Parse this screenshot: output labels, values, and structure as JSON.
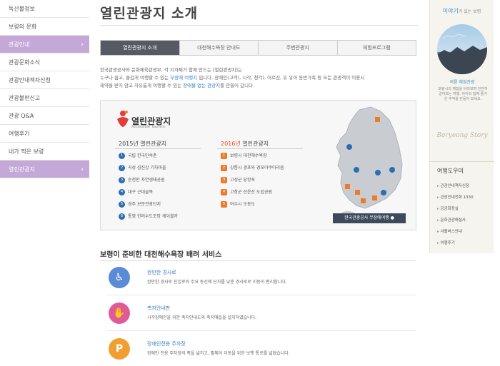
{
  "sidebar": {
    "items": [
      {
        "label": "독산불정보",
        "active": false
      },
      {
        "label": "보령의 문화",
        "active": false
      },
      {
        "label": "관광안내",
        "active": true
      },
      {
        "label": "관광문화소식",
        "active": false
      },
      {
        "label": "관광안내책자신청",
        "active": false
      },
      {
        "label": "관광불편신고",
        "active": false
      },
      {
        "label": "관광 Q&A",
        "active": false
      },
      {
        "label": "여행후기",
        "active": false
      },
      {
        "label": "내가 찍은 보령",
        "active": false
      },
      {
        "label": "열린관광지",
        "active": true
      }
    ]
  },
  "main": {
    "title": "열린관광지 소개",
    "tabs": [
      {
        "label": "열린관광지 소개",
        "active": true
      },
      {
        "label": "대천해수욕장 안내도",
        "active": false
      },
      {
        "label": "주변관광지",
        "active": false
      },
      {
        "label": "체험프로그램",
        "active": false
      }
    ],
    "intro_line1": "한국관광공사와 문화체육관광부, 각 지자체가 함께 만드는 [열린관광지]는",
    "intro_line2a": "누구나 쉽고, 즐겁게 여행할 수 있는 ",
    "intro_line2_hl": "무장애 여행지",
    "intro_line2b": " 입니다. 장애인(고객), 시각, 청각), 어르신, 유 유아 동반가족 등 모든 관광객이 이용시",
    "intro_line3a": "제약을 받지 않고 자유롭게 여행할 수 있는 ",
    "intro_line3_hl": "장애물 없는 관광지",
    "intro_line3b": "를 만들어 갑니다.",
    "logo_text": "열린관광지",
    "logo_sub": "Accessible Tourism",
    "col2015_year": "2015년",
    "col2015_label": " 열린관광지",
    "col2016_year": "2016년",
    "col2016_label": " 열린관광지",
    "sites2015": [
      {
        "num": "1",
        "label": "국립 한국민속촌"
      },
      {
        "num": "2",
        "label": "곡성 섬진강 기차마을"
      },
      {
        "num": "3",
        "label": "순천만 자연생태공원"
      },
      {
        "num": "4",
        "label": "대구 근대골목"
      },
      {
        "num": "5",
        "label": "경주 보문관광단지"
      },
      {
        "num": "6",
        "label": "통영 한려수도조망 케이블카"
      }
    ],
    "sites2016": [
      {
        "num": "1",
        "label": "보령시 대천해수욕장"
      },
      {
        "num": "2",
        "label": "강릉시 경포와 경포아쿠아리움"
      },
      {
        "num": "3",
        "label": "고성군 당항포"
      },
      {
        "num": "4",
        "label": "고창군 선운산 도립공원"
      },
      {
        "num": "5",
        "label": "여수시 오동도"
      }
    ],
    "map_button": "한국관광공사 무장애여행 ●",
    "service_title": "보령이 준비한 대천해수욕장 배려 서비스",
    "services": [
      {
        "title": "완만한 경사로",
        "desc": "완만한 경사로 진입로와 주요 동선에 단차를 낮춘 경사로로 이동이 편리합니다.",
        "icon": "wheelchair-icon",
        "color": "#5b8ad6"
      },
      {
        "title": "촉지안내판",
        "desc": "시각장애인을 위한 촉지안내도와 촉지매듭을 설치하였습니다.",
        "icon": "tactile-hand-icon",
        "color": "#e05a9a"
      },
      {
        "title": "장애인전용 주차장",
        "desc": "장애인 전용 주차장의 폭을 넓히고, 휠체어 이동을 위한 보행 통로를 넓혔습니다.",
        "icon": "parking-accessible-icon",
        "color": "#f0a030"
      }
    ]
  },
  "right": {
    "story_head": "이야기",
    "story_head_small": "가 있는 보령",
    "story_caption": "여름 체험관광",
    "story_text": "보령시의 체험을 바라보며 천천히 걸어보는 여행. 아이와 함께 즐거운 추억을 만들어 보세요.",
    "story_script": "Boryeong Story",
    "travel_head": "여행도우미",
    "travel_links": [
      "관광안내책자신청",
      "관광안내전화 1330",
      "공공화장실",
      "문화관광해설사",
      "셔틀버스안내",
      "여행후기"
    ]
  }
}
